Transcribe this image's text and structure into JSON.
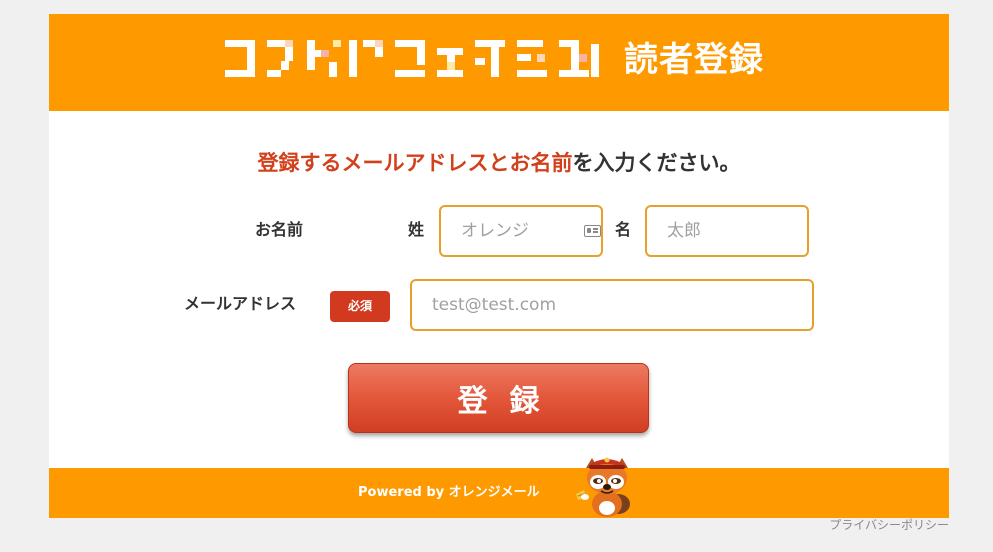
{
  "header": {
    "logo_text": "フラスパーフェアーニュース",
    "title": "読者登録"
  },
  "instruction": {
    "highlight": "登録するメールアドレスとお名前",
    "rest": "を入力ください。"
  },
  "form": {
    "name_label": "お名前",
    "last_name_label": "姓",
    "last_name_placeholder": "オレンジ",
    "first_name_label": "名",
    "first_name_placeholder": "太郎",
    "email_label": "メールアドレス",
    "required_badge": "必須",
    "email_placeholder": "test@test.com",
    "submit_label": "登録"
  },
  "footer": {
    "powered_by": "Powered by オレンジメール"
  },
  "privacy_link": "プライバシーポリシー",
  "colors": {
    "brand_orange": "#ff9900",
    "accent_red": "#d2411c",
    "input_border": "#e8a02c"
  }
}
